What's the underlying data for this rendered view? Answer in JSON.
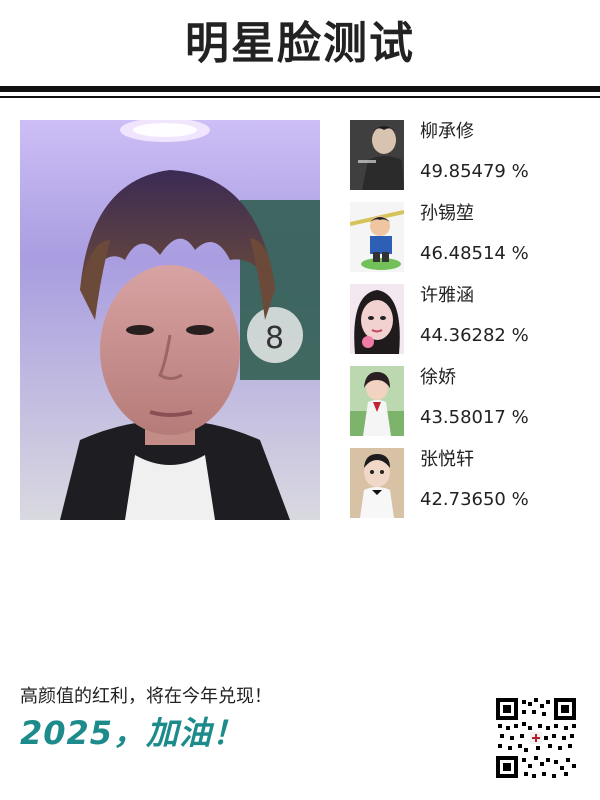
{
  "header": {
    "title": "明星脸测试"
  },
  "matches": [
    {
      "name": "柳承修",
      "percent": "49.85479 %"
    },
    {
      "name": "孙锡堃",
      "percent": "46.48514 %"
    },
    {
      "name": "许雅涵",
      "percent": "44.36282 %"
    },
    {
      "name": "徐娇",
      "percent": "43.58017 %"
    },
    {
      "name": "张悦轩",
      "percent": "42.73650 %"
    }
  ],
  "footer": {
    "tagline": "高颜值的红利，将在今年兑现！",
    "cta": "2025，加油！"
  },
  "colors": {
    "cta": "#1d8b8b",
    "rules": "#111111"
  },
  "icons": {
    "qr": "qr-code-icon"
  }
}
